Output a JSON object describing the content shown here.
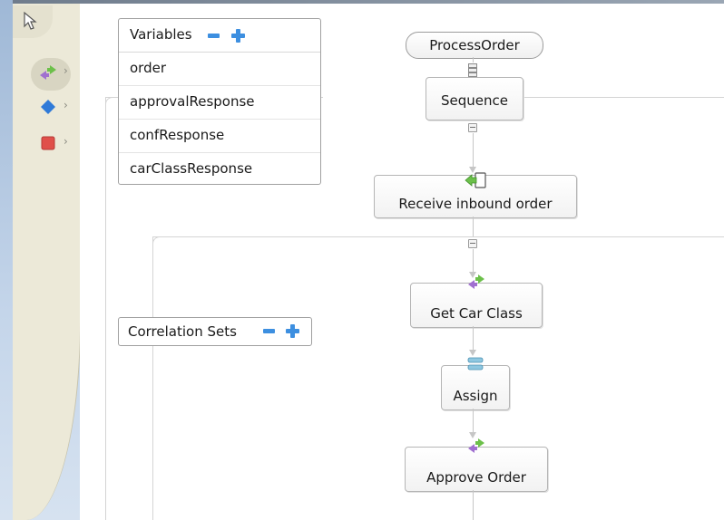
{
  "palette": {
    "items": [
      {
        "icon": "selection-arrow-icon"
      },
      {
        "icon": "invoke-icon"
      },
      {
        "icon": "structured-activity-icon"
      },
      {
        "icon": "fault-activity-icon"
      }
    ]
  },
  "process": {
    "name": "ProcessOrder"
  },
  "variables": {
    "title": "Variables",
    "items": [
      "order",
      "approvalResponse",
      "confResponse",
      "carClassResponse"
    ]
  },
  "correlation_sets": {
    "title": "Correlation Sets"
  },
  "activities": {
    "sequence": "Sequence",
    "receive": "Receive inbound order",
    "get_car_class": "Get Car Class",
    "assign": "Assign",
    "approve_order": "Approve Order"
  },
  "colors": {
    "accent_blue": "#3d8fe0",
    "invoke_purple": "#a070d0",
    "invoke_green": "#6cc04a",
    "fault_red": "#e0504a"
  }
}
